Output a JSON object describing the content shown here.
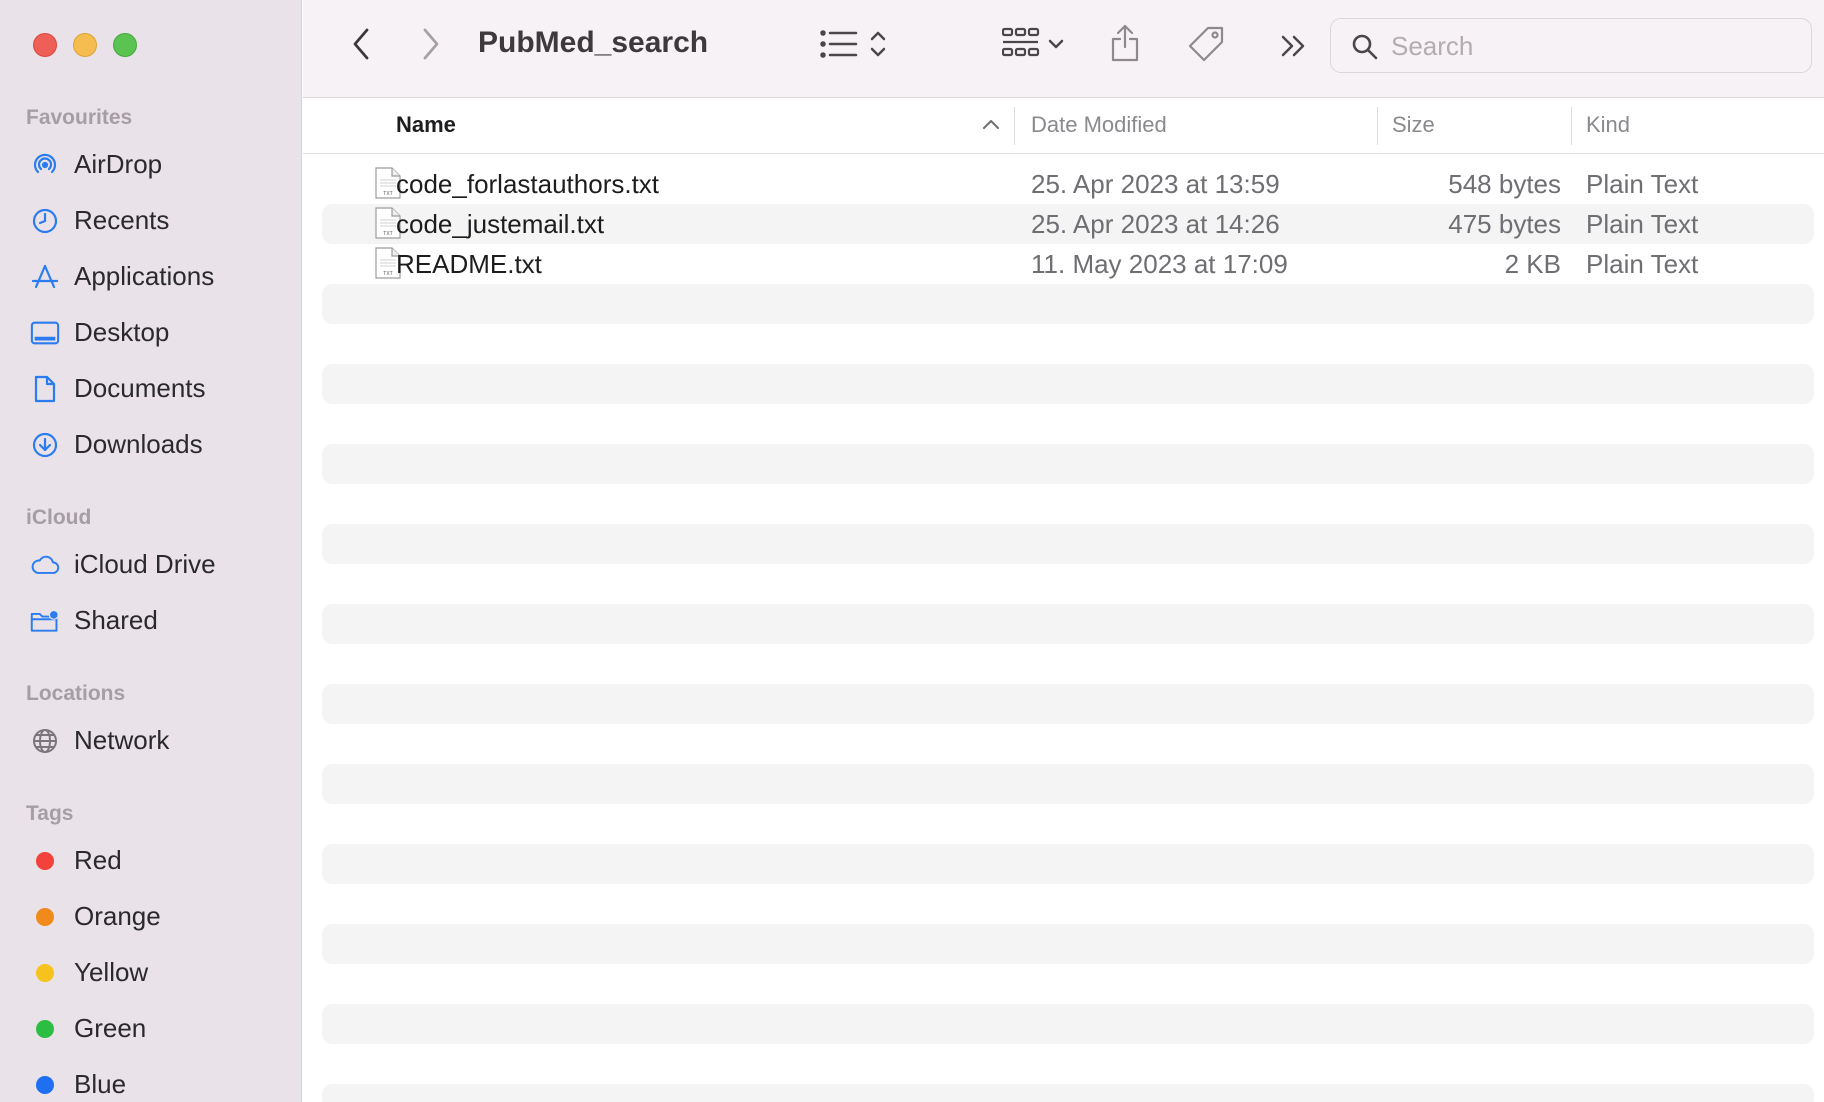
{
  "window": {
    "title": "PubMed_search"
  },
  "sidebar": {
    "favourites_header": "Favourites",
    "favourites": [
      {
        "label": "AirDrop",
        "icon": "airdrop-icon"
      },
      {
        "label": "Recents",
        "icon": "clock-icon"
      },
      {
        "label": "Applications",
        "icon": "applications-icon"
      },
      {
        "label": "Desktop",
        "icon": "desktop-icon"
      },
      {
        "label": "Documents",
        "icon": "document-icon"
      },
      {
        "label": "Downloads",
        "icon": "download-icon"
      }
    ],
    "icloud_header": "iCloud",
    "icloud": [
      {
        "label": "iCloud Drive",
        "icon": "cloud-icon"
      },
      {
        "label": "Shared",
        "icon": "shared-folder-icon"
      }
    ],
    "locations_header": "Locations",
    "locations": [
      {
        "label": "Network",
        "icon": "globe-icon"
      }
    ],
    "tags_header": "Tags",
    "tags": [
      {
        "label": "Red",
        "color": "#f3423b"
      },
      {
        "label": "Orange",
        "color": "#f18a1c"
      },
      {
        "label": "Yellow",
        "color": "#f6c21e"
      },
      {
        "label": "Green",
        "color": "#2cbe42"
      },
      {
        "label": "Blue",
        "color": "#1f6ff3"
      }
    ]
  },
  "toolbar": {
    "search_placeholder": "Search"
  },
  "columns": {
    "name": "Name",
    "date": "Date Modified",
    "size": "Size",
    "kind": "Kind",
    "sort": "ascending"
  },
  "files": [
    {
      "name": "code_forlastauthors.txt",
      "date": "25. Apr 2023 at 13:59",
      "size": "548 bytes",
      "kind": "Plain Text"
    },
    {
      "name": "code_justemail.txt",
      "date": "25. Apr 2023 at 14:26",
      "size": "475 bytes",
      "kind": "Plain Text"
    },
    {
      "name": "README.txt",
      "date": "11. May 2023 at 17:09",
      "size": "2 KB",
      "kind": "Plain Text"
    }
  ],
  "colors": {
    "accent": "#2a7cf0",
    "sidebar_bg": "#e9e2e8",
    "toolbar_bg": "#f7f2f6"
  }
}
